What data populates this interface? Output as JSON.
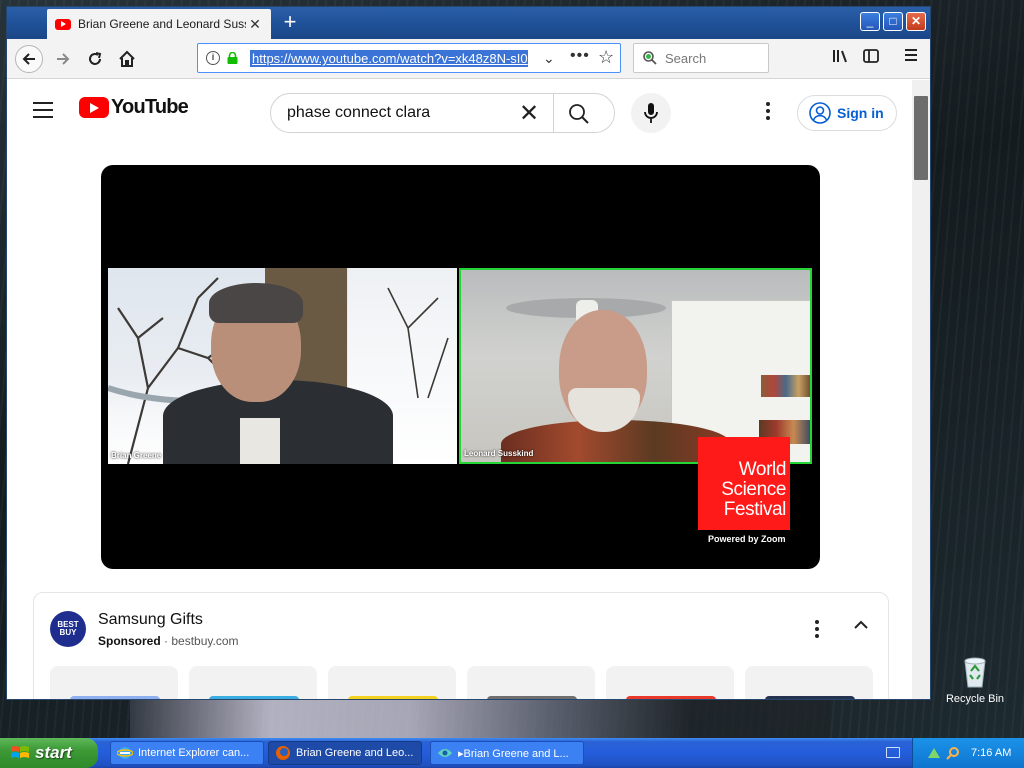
{
  "browser": {
    "tab_title": "Brian Greene and Leonard Susskind",
    "tab_close": "✕",
    "new_tab": "+",
    "url": "https://www.youtube.com/watch?v=xk48z8N-sI0",
    "search_placeholder": "Search",
    "window_controls": {
      "minimize": "_",
      "maximize": "□",
      "close": "✕"
    }
  },
  "youtube": {
    "logo_text": "YouTube",
    "search_query": "phase connect clara",
    "sign_in_label": "Sign in",
    "video": {
      "participants": [
        {
          "name": "Brian Greene"
        },
        {
          "name": "Leonard Susskind"
        }
      ],
      "watermark": {
        "lines": [
          "World",
          "Science",
          "Festival"
        ],
        "powered_by": "Powered by Zoom"
      }
    },
    "ad": {
      "advertiser_avatar_text": "BEST BUY",
      "title": "Samsung Gifts",
      "sponsored_label": "Sponsored",
      "separator": " · ",
      "domain": "bestbuy.com",
      "products": [
        {
          "color": "#8fb0f0"
        },
        {
          "color": "#3aaee0"
        },
        {
          "color": "#f2d21e"
        },
        {
          "color": "#6f6f6f"
        },
        {
          "color": "#e8392a"
        },
        {
          "color": "#26334f"
        }
      ]
    }
  },
  "desktop": {
    "recycle_bin_label": "Recycle Bin"
  },
  "taskbar": {
    "start_label": "start",
    "items": [
      {
        "label": "Internet Explorer can..."
      },
      {
        "label": "Brian Greene and Leo..."
      },
      {
        "label": "▸Brian Greene and L..."
      }
    ],
    "clock": "7:16 AM"
  },
  "colors": {
    "youtube_red": "#ff0000",
    "link_blue": "#065fd4",
    "zoom_speaker_border": "#25d435",
    "xp_taskbar": "#245ddb",
    "xp_start_green": "#3d9a36"
  }
}
